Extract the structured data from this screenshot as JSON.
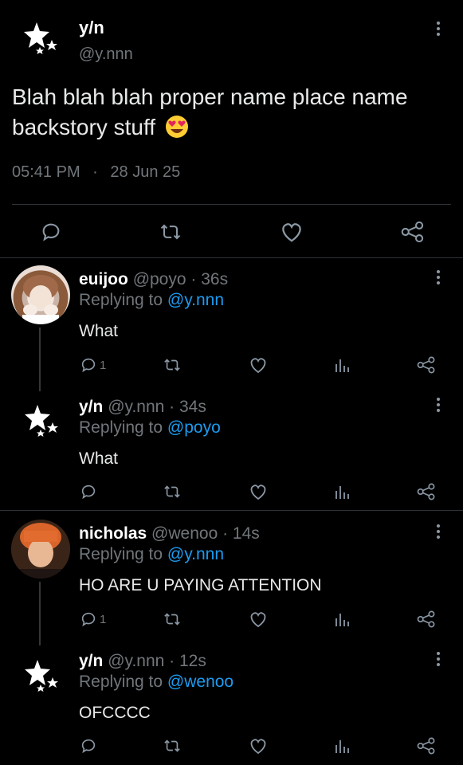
{
  "main_tweet": {
    "name": "y/n",
    "handle": "@y.nnn",
    "text": "Blah blah blah proper name place name backstory stuff",
    "emoji": "heart-eyes",
    "time": "05:41 PM",
    "dot": "·",
    "date": "28 Jun 25"
  },
  "replies": [
    {
      "name": "euijoo",
      "handle": "@poyo",
      "time": "· 36s",
      "replying_label": "Replying to ",
      "replying_to": "@y.nnn",
      "text": "What",
      "reply_count": "1"
    },
    {
      "name": "y/n",
      "handle": "@y.nnn",
      "time": "· 34s",
      "replying_label": "Replying to ",
      "replying_to": "@poyo",
      "text": "What",
      "reply_count": ""
    },
    {
      "name": "nicholas",
      "handle": "@wenoo",
      "time": "· 14s",
      "replying_label": "Replying to ",
      "replying_to": "@y.nnn",
      "text": "HO ARE U PAYING ATTENTION",
      "reply_count": "1"
    },
    {
      "name": "y/n",
      "handle": "@y.nnn",
      "time": "· 12s",
      "replying_label": "Replying to ",
      "replying_to": "@wenoo",
      "text": "OFCCCC",
      "reply_count": ""
    }
  ],
  "icons": [
    "more-icon",
    "reply-icon",
    "retweet-icon",
    "like-icon",
    "share-icon",
    "views-icon"
  ],
  "colors": {
    "background": "#000000",
    "muted": "#71767b",
    "link": "#1d9bf0",
    "divider": "#2f3336"
  }
}
